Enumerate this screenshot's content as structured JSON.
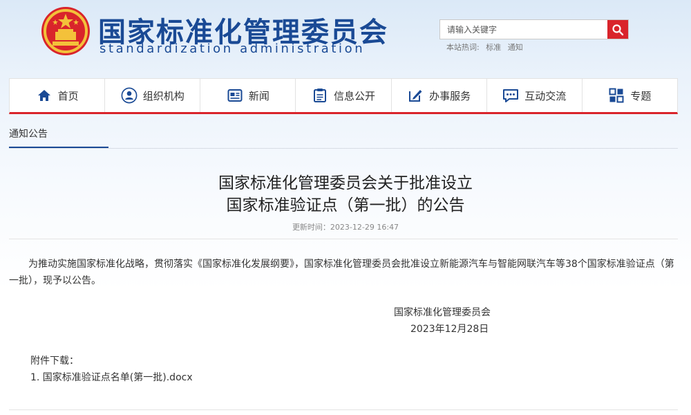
{
  "header": {
    "title_cn": "国家标准化管理委员会",
    "title_en": "standardization administration",
    "search": {
      "placeholder": "请输入关键字",
      "hot_label": "本站热词:",
      "hot_words": [
        "标准",
        "通知"
      ]
    }
  },
  "nav": {
    "items": [
      {
        "label": "首页",
        "icon": "home-icon"
      },
      {
        "label": "组织机构",
        "icon": "person-icon"
      },
      {
        "label": "新闻",
        "icon": "newspaper-icon"
      },
      {
        "label": "信息公开",
        "icon": "document-icon"
      },
      {
        "label": "办事服务",
        "icon": "edit-icon"
      },
      {
        "label": "互动交流",
        "icon": "chat-icon"
      },
      {
        "label": "专题",
        "icon": "topic-icon"
      }
    ]
  },
  "section": {
    "label": "通知公告"
  },
  "article": {
    "title_line1": "国家标准化管理委员会关于批准设立",
    "title_line2": "国家标准验证点（第一批）的公告",
    "update_time": "更新时间：2023-12-29 16:47",
    "body": "为推动实施国家标准化战略，贯彻落实《国家标准化发展纲要》，国家标准化管理委员会批准设立新能源汽车与智能网联汽车等38个国家标准验证点（第一批），现予以公告。",
    "sign_org": "国家标准化管理委员会",
    "sign_date": "2023年12月28日",
    "attachments_title": "附件下载：",
    "attachments": [
      "1. 国家标准验证点名单(第一批).docx"
    ]
  },
  "colors": {
    "brand_blue": "#1a4a95",
    "accent_red": "#d9242b"
  }
}
